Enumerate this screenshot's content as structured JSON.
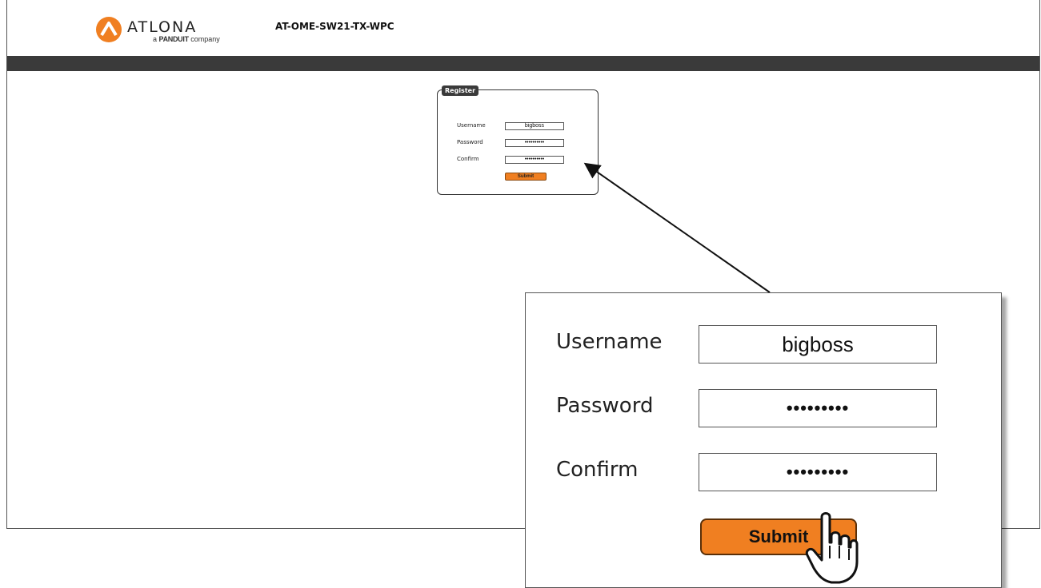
{
  "header": {
    "brand": "ATLONA",
    "brand_sub_prefix": "a",
    "brand_sub_company": "PANDUIT",
    "brand_sub_suffix": "company",
    "device_model": "AT-OME-SW21-TX-WPC"
  },
  "register": {
    "title": "Register",
    "username_label": "Username",
    "username_value": "bigboss",
    "password_label": "Password",
    "password_value": "••••••••••",
    "confirm_label": "Confirm",
    "confirm_value": "••••••••••",
    "submit_label": "Submit"
  },
  "zoom": {
    "username_label": "Username",
    "username_value": "bigboss",
    "password_label": "Password",
    "password_value": "•••••••••",
    "confirm_label": "Confirm",
    "confirm_value": "•••••••••",
    "submit_label": "Submit"
  },
  "icons": {
    "logo": "atlona-logo-icon",
    "pointer": "hand-pointer-icon"
  },
  "colors": {
    "accent": "#f07f21",
    "navbar": "#3a3a3a"
  }
}
